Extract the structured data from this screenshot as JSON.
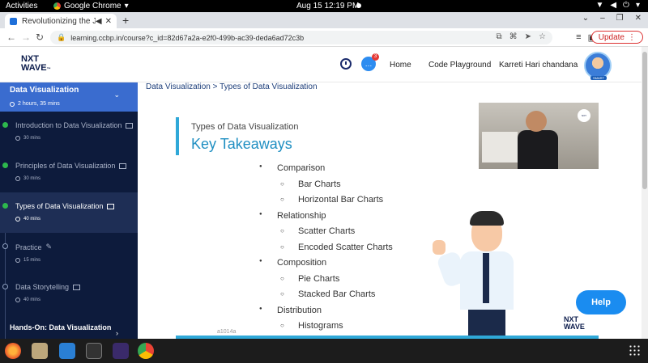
{
  "system": {
    "activities": "Activities",
    "app": "Google Chrome",
    "clock": "Aug 15  12:19 PM"
  },
  "browser": {
    "tab_title": "Revolutionizing the Jo",
    "url": "learning.ccbp.in/course?c_id=82d67a2a-e2f0-499b-ac39-deda6ad72c3b",
    "update_label": "Update"
  },
  "header": {
    "logo_line1": "NXT",
    "logo_line2": "WAVE",
    "notification_count": "3",
    "home": "Home",
    "code_playground": "Code Playground",
    "user_name": "Karreti Hari chandana",
    "avatar_tag": "SMART"
  },
  "sidebar": {
    "module_title": "Data Visualization",
    "module_duration": "2 hours, 35 mins",
    "items": [
      {
        "label": "Introduction to Data Visualization",
        "mins": "30 mins"
      },
      {
        "label": "Principles of Data Visualization",
        "mins": "30 mins"
      },
      {
        "label": "Types of Data Visualization",
        "mins": "40 mins"
      },
      {
        "label": "Practice",
        "mins": "15 mins"
      },
      {
        "label": "Data Storytelling",
        "mins": "40 mins"
      }
    ],
    "next_module": "Hands-On: Data Visualization"
  },
  "content": {
    "breadcrumb": "Data Visualization > Types of Data Visualization",
    "slide_subtitle": "Types of Data Visualization",
    "slide_title": "Key Takeaways",
    "takeaways": [
      {
        "cat": "Comparison",
        "items": [
          "Bar Charts",
          "Horizontal Bar Charts"
        ]
      },
      {
        "cat": "Relationship",
        "items": [
          "Scatter Charts",
          "Encoded Scatter Charts"
        ]
      },
      {
        "cat": "Composition",
        "items": [
          "Pie Charts",
          "Stacked Bar Charts"
        ]
      },
      {
        "cat": "Distribution",
        "items": [
          "Histograms"
        ]
      }
    ],
    "watermark_id": "a1014a",
    "watermark_logo1": "NXT",
    "watermark_logo2": "WAVE",
    "help": "Help"
  }
}
